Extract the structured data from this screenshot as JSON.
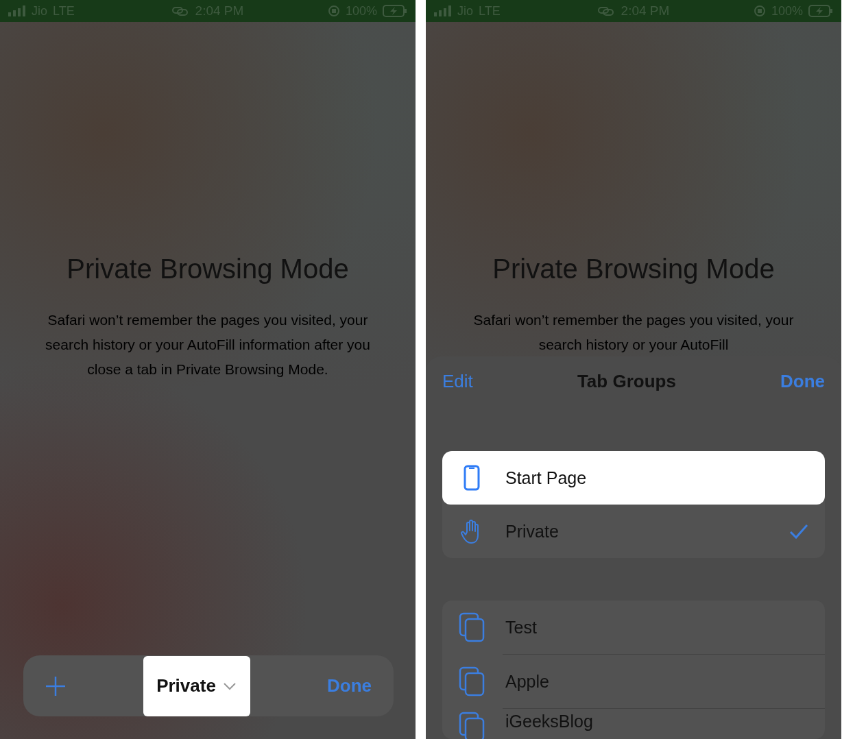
{
  "screens": [
    {
      "status_bar": {
        "carrier": "Jio",
        "network": "LTE",
        "time": "2:04 PM",
        "battery": "100%"
      },
      "heading": "Private Browsing Mode",
      "message": "Safari won’t remember the pages you visited, your search history or your AutoFill information after you close a tab in Private Browsing Mode.",
      "toolbar": {
        "group_label": "Private",
        "highlighted": true,
        "done": "Done"
      }
    },
    {
      "status_bar": {
        "carrier": "Jio",
        "network": "LTE",
        "time": "2:04 PM",
        "battery": "100%"
      },
      "heading": "Private Browsing Mode",
      "message": "Safari won’t remember the pages you visited, your search history or your AutoFill",
      "sheet": {
        "edit": "Edit",
        "title": "Tab Groups",
        "done": "Done",
        "sections": [
          {
            "items": [
              {
                "kind": "phone",
                "label": "Start Page",
                "highlighted": true,
                "checked": false
              },
              {
                "kind": "hand",
                "label": "Private",
                "highlighted": false,
                "checked": true
              }
            ]
          },
          {
            "items": [
              {
                "kind": "tabs",
                "label": "Test",
                "highlighted": false,
                "checked": false
              },
              {
                "kind": "tabs",
                "label": "Apple",
                "highlighted": false,
                "checked": false
              },
              {
                "kind": "tabs",
                "label": "iGeeksBlog",
                "highlighted": false,
                "checked": false
              }
            ]
          }
        ]
      }
    }
  ]
}
